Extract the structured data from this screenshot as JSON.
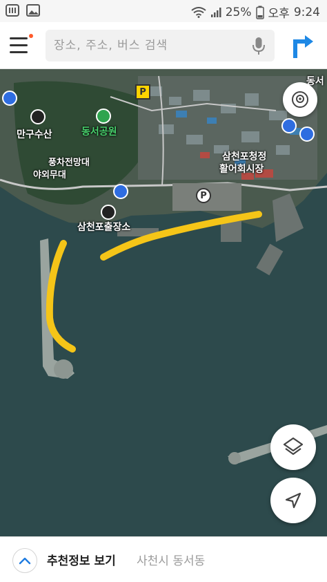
{
  "status_bar": {
    "battery": "25%",
    "ampm": "오후",
    "time": "9:24"
  },
  "search": {
    "placeholder": "장소, 주소, 버스 검색"
  },
  "map": {
    "labels": {
      "dongseo_top": "동서",
      "mangu_susan": "만구수산",
      "dongseo_park": "동서공원",
      "pungcha": "풍차전망대",
      "outdoor_stage": "야외무대",
      "samcheonpo_market_1": "삼천포청정",
      "samcheonpo_market_2": "활어회시장",
      "samcheonpo_outlet": "삼천포출장소"
    },
    "icons": {
      "parking": "P"
    },
    "highlight_color": "#f5c518"
  },
  "bottom": {
    "title": "추천정보 보기",
    "location": "사천시 동서동"
  }
}
